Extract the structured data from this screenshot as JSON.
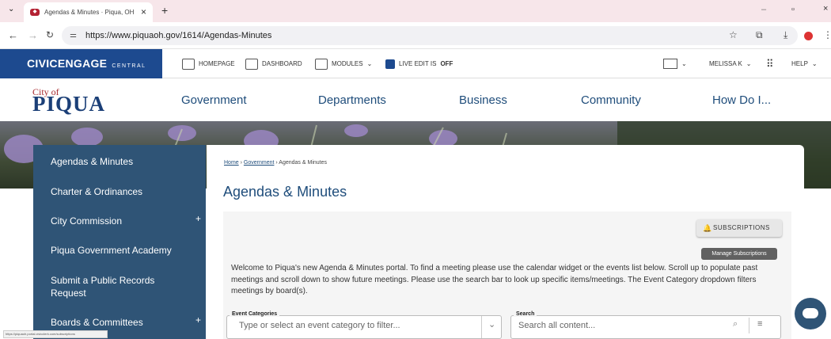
{
  "browser": {
    "tab_title": "Agendas & Minutes · Piqua, OH",
    "url": "https://www.piquaoh.gov/1614/Agendas-Minutes",
    "status_url": "https://piquaoh.portal.civicclerk.com/subscriptions"
  },
  "cms": {
    "brand": "CIVICENGAGE",
    "brand_sub": "CENTRAL",
    "homepage": "HOMEPAGE",
    "dashboard": "DASHBOARD",
    "modules": "MODULES",
    "live_edit": "LIVE EDIT IS",
    "live_edit_state": "OFF",
    "user": "MELISSA K",
    "help": "HELP"
  },
  "site": {
    "logo_city": "City of",
    "logo_name": "PIQUA",
    "nav": [
      "Government",
      "Departments",
      "Business",
      "Community",
      "How Do I..."
    ]
  },
  "sidebar": {
    "items": [
      {
        "label": "Agendas & Minutes",
        "plus": ""
      },
      {
        "label": "Charter & Ordinances",
        "plus": ""
      },
      {
        "label": "City Commission",
        "plus": "+"
      },
      {
        "label": "Piqua Government Academy",
        "plus": ""
      },
      {
        "label": "Submit a Public Records",
        "label2": "Request",
        "plus": ""
      },
      {
        "label": "Boards & Committees",
        "plus": "+"
      }
    ]
  },
  "page": {
    "breadcrumb": [
      "Home",
      "Government",
      "Agendas & Minutes"
    ],
    "title": "Agendas & Minutes",
    "subscriptions": "SUBSCRIPTIONS",
    "tooltip": "Manage Subscriptions",
    "intro": "Welcome to Piqua's new Agenda & Minutes portal. To find a meeting please use the calendar widget or the events list below. Scroll up to populate past meetings and scroll down to show future meetings. Please use the search bar to look up specific items/meetings. The Event Category dropdown filters meetings by board(s).",
    "event_categories_label": "Event Categories",
    "event_categories_placeholder": "Type or select an event category to filter...",
    "search_label": "Search",
    "search_placeholder": "Search all content..."
  },
  "colors": {
    "brand_blue": "#1d4a8f",
    "sidebar": "#2f5476",
    "accent_red": "#a82a2f"
  }
}
